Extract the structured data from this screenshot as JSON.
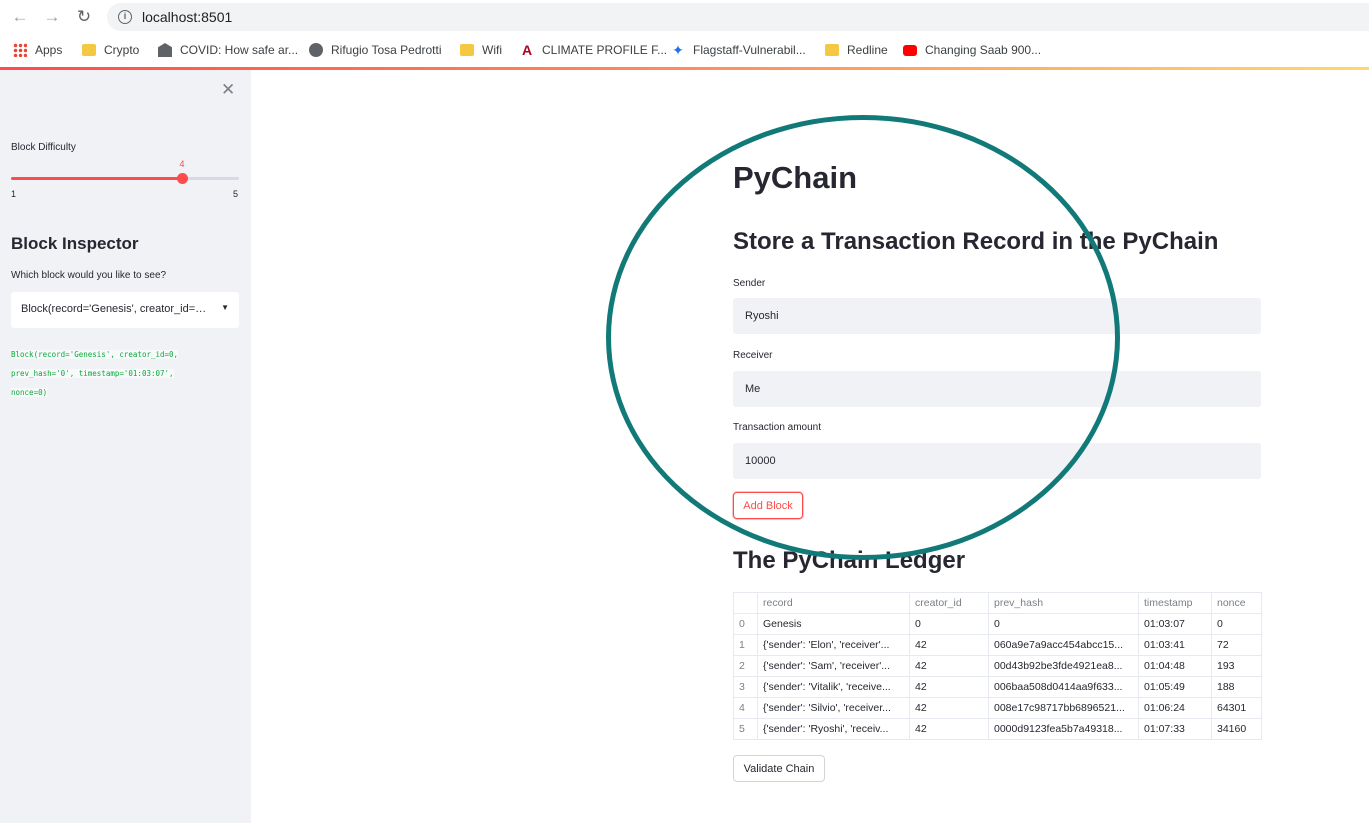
{
  "browser": {
    "url": "localhost:8501",
    "bookmarks": [
      {
        "label": "Apps",
        "icon": "apps-grid-icon"
      },
      {
        "label": "Crypto",
        "icon": "folder-icon"
      },
      {
        "label": "COVID: How safe ar...",
        "icon": "bank-icon"
      },
      {
        "label": "Rifugio Tosa Pedrotti",
        "icon": "globe-icon"
      },
      {
        "label": "Wifi",
        "icon": "folder-icon"
      },
      {
        "label": "CLIMATE PROFILE F...",
        "icon": "university-logo-icon"
      },
      {
        "label": "Flagstaff-Vulnerabil...",
        "icon": "star-logo-icon"
      },
      {
        "label": "Redline",
        "icon": "folder-icon"
      },
      {
        "label": "Changing Saab 900...",
        "icon": "youtube-icon"
      }
    ]
  },
  "sidebar": {
    "slider_label": "Block Difficulty",
    "slider_value": "4",
    "slider_min": "1",
    "slider_max": "5",
    "slider_fraction": 0.75,
    "inspector_title": "Block Inspector",
    "inspector_question": "Which block would you like to see?",
    "selected_block": "Block(record='Genesis', creator_id=0, prev_hash='0', timestamp='01:03:07', nonce=0)",
    "code_lines": [
      "Block(record='Genesis', creator_id=0,",
      "prev_hash='0', timestamp='01:03:07',",
      "nonce=0)"
    ]
  },
  "main": {
    "title": "PyChain",
    "store_heading": "Store a Transaction Record in the PyChain",
    "sender_label": "Sender",
    "sender_value": "Ryoshi",
    "receiver_label": "Receiver",
    "receiver_value": "Me",
    "amount_label": "Transaction amount",
    "amount_value": "10000",
    "add_block_label": "Add Block",
    "ledger_heading": "The PyChain Ledger",
    "validate_label": "Validate Chain",
    "columns": [
      "",
      "record",
      "creator_id",
      "prev_hash",
      "timestamp",
      "nonce"
    ],
    "rows": [
      [
        "0",
        "Genesis",
        "0",
        "0",
        "01:03:07",
        "0"
      ],
      [
        "1",
        "{'sender': 'Elon', 'receiver'...",
        "42",
        "060a9e7a9acc454abcc15...",
        "01:03:41",
        "72"
      ],
      [
        "2",
        "{'sender': 'Sam', 'receiver'...",
        "42",
        "00d43b92be3fde4921ea8...",
        "01:04:48",
        "193"
      ],
      [
        "3",
        "{'sender': 'Vitalik', 'receive...",
        "42",
        "006baa508d0414aa9f633...",
        "01:05:49",
        "188"
      ],
      [
        "4",
        "{'sender': 'Silvio', 'receiver...",
        "42",
        "008e17c98717bb6896521...",
        "01:06:24",
        "64301"
      ],
      [
        "5",
        "{'sender': 'Ryoshi', 'receiv...",
        "42",
        "0000d9123fea5b7a49318...",
        "01:07:33",
        "34160"
      ]
    ]
  },
  "colors": {
    "accent": "#ff4b4b",
    "sidebar_bg": "#f0f2f6",
    "annotation": "#117a78",
    "code_green": "#09ab3b"
  }
}
